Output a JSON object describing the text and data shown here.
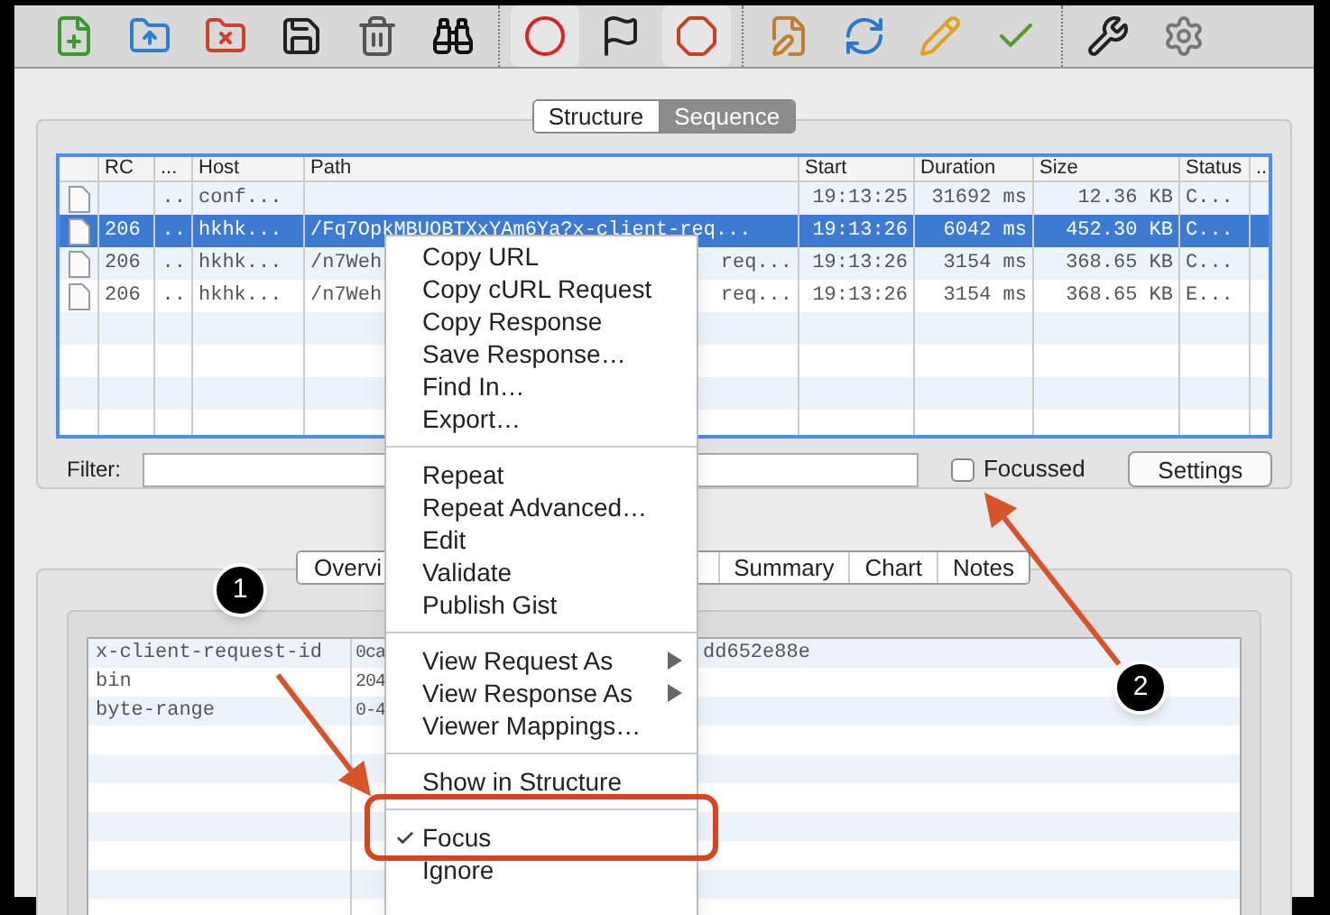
{
  "toolbar": {
    "groups": [
      [
        {
          "pressed": false
        },
        {
          "pressed": false
        },
        {
          "pressed": false
        },
        {
          "pressed": false
        },
        {
          "pressed": false
        },
        {
          "pressed": false
        }
      ],
      [
        {
          "pressed": true
        },
        {
          "pressed": false
        },
        {
          "pressed": true
        }
      ],
      [
        {
          "pressed": false
        },
        {
          "pressed": false
        },
        {
          "pressed": false
        },
        {
          "pressed": false
        }
      ],
      [
        {
          "pressed": false
        },
        {
          "pressed": false
        }
      ]
    ]
  },
  "view_tabs": [
    {
      "label": "Structure",
      "selected": false
    },
    {
      "label": "Sequence",
      "selected": true
    }
  ],
  "table": {
    "columns": [
      "RC",
      "...",
      "Host",
      "Path",
      "Start",
      "Duration",
      "Size",
      "Status",
      "..."
    ],
    "rows": [
      {
        "selected": false,
        "dots": "..",
        "host": "conf...",
        "start": "19:13:25",
        "duration": "31692 ms",
        "size": "12.36 KB",
        "status": "C..."
      },
      {
        "selected": true,
        "rc": "206",
        "dots": "..",
        "host": "hkhk...",
        "path": "/Fq7OpkMBUOBTXxYAm6Ya?x-client-req...",
        "start": "19:13:26",
        "duration": "6042 ms",
        "size": "452.30 KB",
        "status": "C..."
      },
      {
        "selected": false,
        "rc": "206",
        "dots": "..",
        "host": "hkhk...",
        "path": "/n7Weh",
        "path_tail": "req...",
        "start": "19:13:26",
        "duration": "3154 ms",
        "size": "368.65 KB",
        "status": "C..."
      },
      {
        "selected": false,
        "rc": "206",
        "dots": "..",
        "host": "hkhk...",
        "path": "/n7Weh",
        "path_tail": "req...",
        "start": "19:13:26",
        "duration": "3154 ms",
        "size": "368.65 KB",
        "status": "E..."
      }
    ]
  },
  "filter": {
    "label": "Filter:"
  },
  "focussed": {
    "label": "Focussed",
    "checked": false
  },
  "settings_button": "Settings",
  "detail_tabs": [
    {
      "label": "Overvi",
      "selected": false
    },
    {
      "label": "Summary",
      "selected": false
    },
    {
      "label": "Chart",
      "selected": false
    },
    {
      "label": "Notes",
      "selected": false
    }
  ],
  "headers": [
    {
      "name": "x-client-request-id",
      "value": "0ca",
      "value_tail": "dd652e88e"
    },
    {
      "name": "bin",
      "value": "204"
    },
    {
      "name": "byte-range",
      "value": "0-4"
    }
  ],
  "context_menu": [
    [
      {
        "label": "Copy URL",
        "submenu": false,
        "checked": false
      },
      {
        "label": "Copy cURL Request",
        "submenu": false,
        "checked": false
      },
      {
        "label": "Copy Response",
        "submenu": false,
        "checked": false
      },
      {
        "label": "Save Response…",
        "submenu": false,
        "checked": false
      },
      {
        "label": "Find In…",
        "submenu": false,
        "checked": false
      },
      {
        "label": "Export…",
        "submenu": false,
        "checked": false
      }
    ],
    [
      {
        "label": "Repeat",
        "submenu": false,
        "checked": false
      },
      {
        "label": "Repeat Advanced…",
        "submenu": false,
        "checked": false
      },
      {
        "label": "Edit",
        "submenu": false,
        "checked": false
      },
      {
        "label": "Validate",
        "submenu": false,
        "checked": false
      },
      {
        "label": "Publish Gist",
        "submenu": false,
        "checked": false
      }
    ],
    [
      {
        "label": "View Request As",
        "submenu": true,
        "checked": false
      },
      {
        "label": "View Response As",
        "submenu": true,
        "checked": false
      },
      {
        "label": "Viewer Mappings…",
        "submenu": false,
        "checked": false
      }
    ],
    [
      {
        "label": "Show in Structure",
        "submenu": false,
        "checked": false
      }
    ],
    [
      {
        "label": "Focus",
        "submenu": false,
        "checked": true
      },
      {
        "label": "Ignore",
        "submenu": false,
        "checked": false
      }
    ]
  ],
  "annotations": [
    {
      "label": "1"
    },
    {
      "label": "2"
    }
  ]
}
